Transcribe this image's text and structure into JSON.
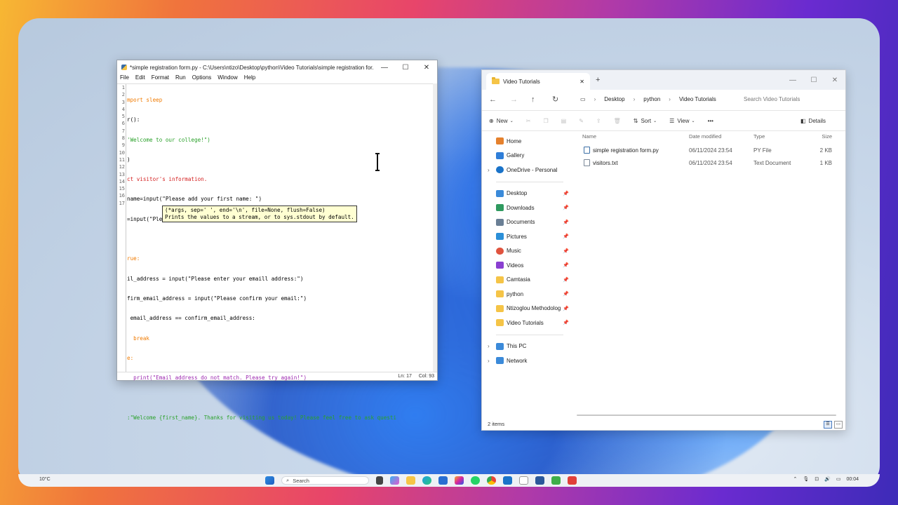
{
  "idle": {
    "title": "*simple registration form.py - C:\\Users\\ntizo\\Desktop\\python\\Video Tutorials\\simple registration for...",
    "menu": [
      "File",
      "Edit",
      "Format",
      "Run",
      "Options",
      "Window",
      "Help"
    ],
    "line_numbers": [
      "1",
      "2",
      "3",
      "4",
      "5",
      "6",
      "7",
      "8",
      "9",
      "10",
      "11",
      "12",
      "13",
      "14",
      "15",
      "16",
      "17"
    ],
    "code_lines": [
      "mport sleep",
      "r():",
      "'Welcome to our college!\")",
      ")",
      "ct visitor's information.",
      "name=input(\"Please add your first name: \")",
      "=input(\"Please add your surname: \")",
      "",
      "rue:",
      "il_address = input(\"Please enter your emaill address:\")",
      "firm_email_address = input(\"Please confirm your email:\")",
      " email_address == confirm_email_address:",
      "  break",
      "e:",
      "  print(\"Email address do not match. Please try again!\")",
      "",
      ":\"Welcome {first_name}. Thanks for visiting us today! Please feel free to ask questi"
    ],
    "calltip_line1": "(*args, sep=' ', end='\\n', file=None, flush=False)",
    "calltip_line2": "Prints the values to a stream, or to sys.stdout by default.",
    "status_ln": "Ln: 17",
    "status_col": "Col: 93",
    "win_min": "—",
    "win_max": "☐",
    "win_close": "✕"
  },
  "explorer": {
    "tab_title": "Video Tutorials",
    "tab_close": "✕",
    "new_tab": "+",
    "breadcrumb": [
      "Desktop",
      "python",
      "Video Tutorials"
    ],
    "search_placeholder": "Search Video Tutorials",
    "new_label": "New",
    "sort_label": "Sort",
    "view_label": "View",
    "more_label": "•••",
    "details_label": "Details",
    "nav_top": [
      {
        "label": "Home",
        "icon": "home-icon",
        "color": "#e5812d"
      },
      {
        "label": "Gallery",
        "icon": "gallery-icon",
        "color": "#2f7ed8"
      },
      {
        "label": "OneDrive - Personal",
        "icon": "onedrive-icon",
        "color": "#1a73c9"
      }
    ],
    "nav_pinned": [
      {
        "label": "Desktop",
        "icon": "desktop-icon",
        "color": "#3b8ad9"
      },
      {
        "label": "Downloads",
        "icon": "downloads-icon",
        "color": "#2f9a5f"
      },
      {
        "label": "Documents",
        "icon": "documents-icon",
        "color": "#6a7f95"
      },
      {
        "label": "Pictures",
        "icon": "pictures-icon",
        "color": "#2b8fd8"
      },
      {
        "label": "Music",
        "icon": "music-icon",
        "color": "#e0533e"
      },
      {
        "label": "Videos",
        "icon": "videos-icon",
        "color": "#8a3fd1"
      },
      {
        "label": "Camtasia",
        "icon": "folder-icon",
        "color": "#f5c447"
      },
      {
        "label": "python",
        "icon": "folder-icon",
        "color": "#f5c447"
      },
      {
        "label": "Ntizoglou Methodolog",
        "icon": "folder-icon",
        "color": "#f5c447"
      },
      {
        "label": "Video Tutorials",
        "icon": "folder-icon",
        "color": "#f5c447"
      }
    ],
    "nav_bottom": [
      {
        "label": "This PC",
        "icon": "pc-icon",
        "color": "#3b8ad9"
      },
      {
        "label": "Network",
        "icon": "network-icon",
        "color": "#3b8ad9"
      }
    ],
    "columns": {
      "name": "Name",
      "date": "Date modified",
      "type": "Type",
      "size": "Size"
    },
    "files": [
      {
        "name": "simple registration form.py",
        "date": "06/11/2024 23:54",
        "type": "PY File",
        "size": "2 KB"
      },
      {
        "name": "visitors.txt",
        "date": "06/11/2024 23:54",
        "type": "Text Document",
        "size": "1 KB"
      }
    ],
    "status": "2 items"
  },
  "taskbar": {
    "weather": "10°C",
    "search_label": "Search",
    "time": "00:04"
  }
}
